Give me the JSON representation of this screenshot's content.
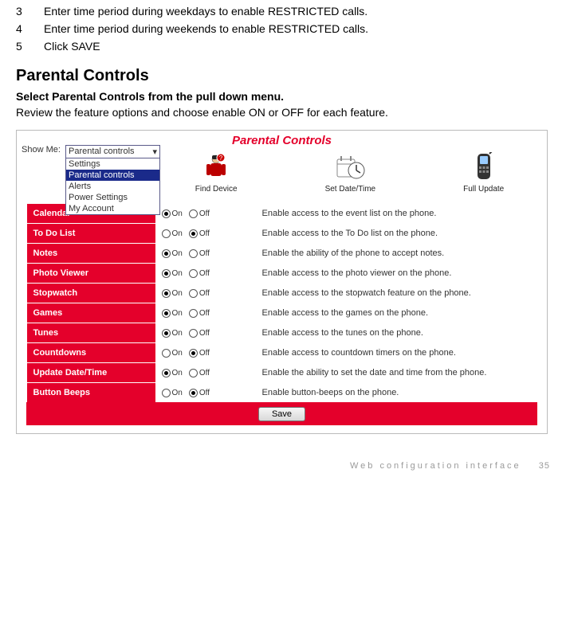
{
  "steps": [
    {
      "num": "3",
      "text": "Enter time period during weekdays to enable RESTRICTED calls."
    },
    {
      "num": "4",
      "text": "Enter time period during weekends to enable RESTRICTED calls."
    },
    {
      "num": "5",
      "text": "Click SAVE"
    }
  ],
  "heading": "Parental Controls",
  "sub_bold": "Select Parental Controls from the pull down menu.",
  "sub_plain": "Review the feature options and choose enable ON or OFF for each feature.",
  "shot": {
    "title": "Parental Controls",
    "show_me_label": "Show Me:",
    "select_options": [
      {
        "label": "Settings",
        "selected": false
      },
      {
        "label": "Parental controls",
        "selected": true
      },
      {
        "label": "Alerts",
        "selected": false
      },
      {
        "label": "Power Settings",
        "selected": false
      },
      {
        "label": "My Account",
        "selected": false
      }
    ],
    "select_top": "Parental controls",
    "icons": [
      {
        "label": "Find Device"
      },
      {
        "label": "Set Date/Time"
      },
      {
        "label": "Full Update"
      }
    ],
    "on_label": "On",
    "off_label": "Off",
    "rows": [
      {
        "name": "Calendar",
        "on": true,
        "desc": "Enable access to the event list on the phone."
      },
      {
        "name": "To Do List",
        "on": false,
        "desc": "Enable access to the To Do list on the phone."
      },
      {
        "name": "Notes",
        "on": true,
        "desc": "Enable the ability of the phone to accept notes."
      },
      {
        "name": "Photo Viewer",
        "on": true,
        "desc": "Enable access to the photo viewer on the phone."
      },
      {
        "name": "Stopwatch",
        "on": true,
        "desc": "Enable access to the stopwatch feature on the phone."
      },
      {
        "name": "Games",
        "on": true,
        "desc": "Enable access to the games on the phone."
      },
      {
        "name": "Tunes",
        "on": true,
        "desc": "Enable access to the tunes on the phone."
      },
      {
        "name": "Countdowns",
        "on": false,
        "desc": "Enable access to countdown timers on the phone."
      },
      {
        "name": "Update Date/Time",
        "on": true,
        "desc": "Enable the ability to set the date and time from the phone."
      },
      {
        "name": "Button Beeps",
        "on": false,
        "desc": "Enable button-beeps on the phone."
      }
    ],
    "save": "Save"
  },
  "footer": {
    "label": "Web configuration interface",
    "page": "35"
  }
}
